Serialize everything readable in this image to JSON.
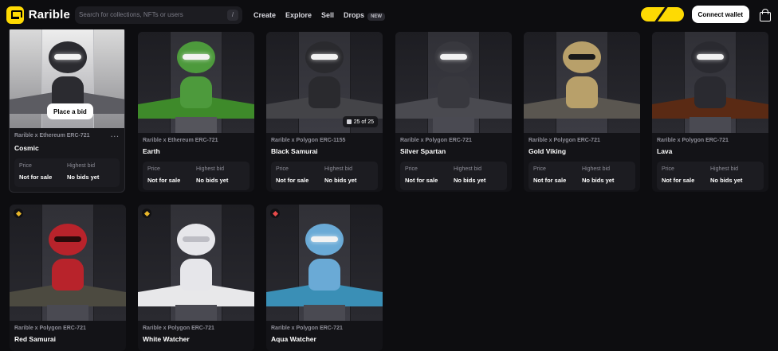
{
  "header": {
    "logo_text": "Rarible",
    "search_placeholder": "Search for collections, NFTs or users",
    "search_shortcut": "/",
    "nav": [
      "Create",
      "Explore",
      "Sell",
      "Drops"
    ],
    "drops_badge": "NEW",
    "connect_wallet": "Connect wallet",
    "accent_color": "#feda03"
  },
  "labels": {
    "price": "Price",
    "highest_bid": "Highest bid",
    "place_bid": "Place a bid"
  },
  "cards": [
    {
      "collection": "Rarible x Ethereum ERC-721",
      "name": "Cosmic",
      "price": "Not for sale",
      "highest_bid": "No bids yet",
      "more": "···",
      "fig": "#2b2b30",
      "floor": "#5c5c62"
    },
    {
      "collection": "Rarible x Ethereum ERC-721",
      "name": "Earth",
      "price": "Not for sale",
      "highest_bid": "No bids yet",
      "fig": "#4d9a3c",
      "floor": "#3e8a2a"
    },
    {
      "collection": "Rarible x Polygon ERC-1155",
      "name": "Black Samurai",
      "price": "Not for sale",
      "highest_bid": "No bids yet",
      "edition": "25 of 25",
      "fig": "#2a2a2e",
      "floor": "#444448"
    },
    {
      "collection": "Rarible x Polygon ERC-721",
      "name": "Silver Spartan",
      "price": "Not for sale",
      "highest_bid": "No bids yet",
      "fig": "#38383e",
      "floor": "#2b2b30"
    },
    {
      "collection": "Rarible x Polygon ERC-721",
      "name": "Gold Viking",
      "price": "Not for sale",
      "highest_bid": "No bids yet",
      "fig": "#b8a06a",
      "floor": "#5a5650"
    },
    {
      "collection": "Rarible x Polygon ERC-721",
      "name": "Lava",
      "price": "Not for sale",
      "highest_bid": "No bids yet",
      "fig": "#2a2a30",
      "floor": "#5a2a14"
    },
    {
      "collection": "Rarible x Polygon ERC-721",
      "name": "Red Samurai",
      "fig": "#b8232b",
      "floor": "#4c4a40",
      "badge": "#e8b62a"
    },
    {
      "collection": "Rarible x Polygon ERC-721",
      "name": "White Watcher",
      "fig": "#e6e6ea",
      "floor": "#d4c27a",
      "badge": "#e8b62a"
    },
    {
      "collection": "Rarible x Polygon ERC-721",
      "name": "Aqua Watcher",
      "fig": "#6aaad6",
      "floor": "#3a8fb6",
      "badge": "#e84a4a"
    }
  ]
}
